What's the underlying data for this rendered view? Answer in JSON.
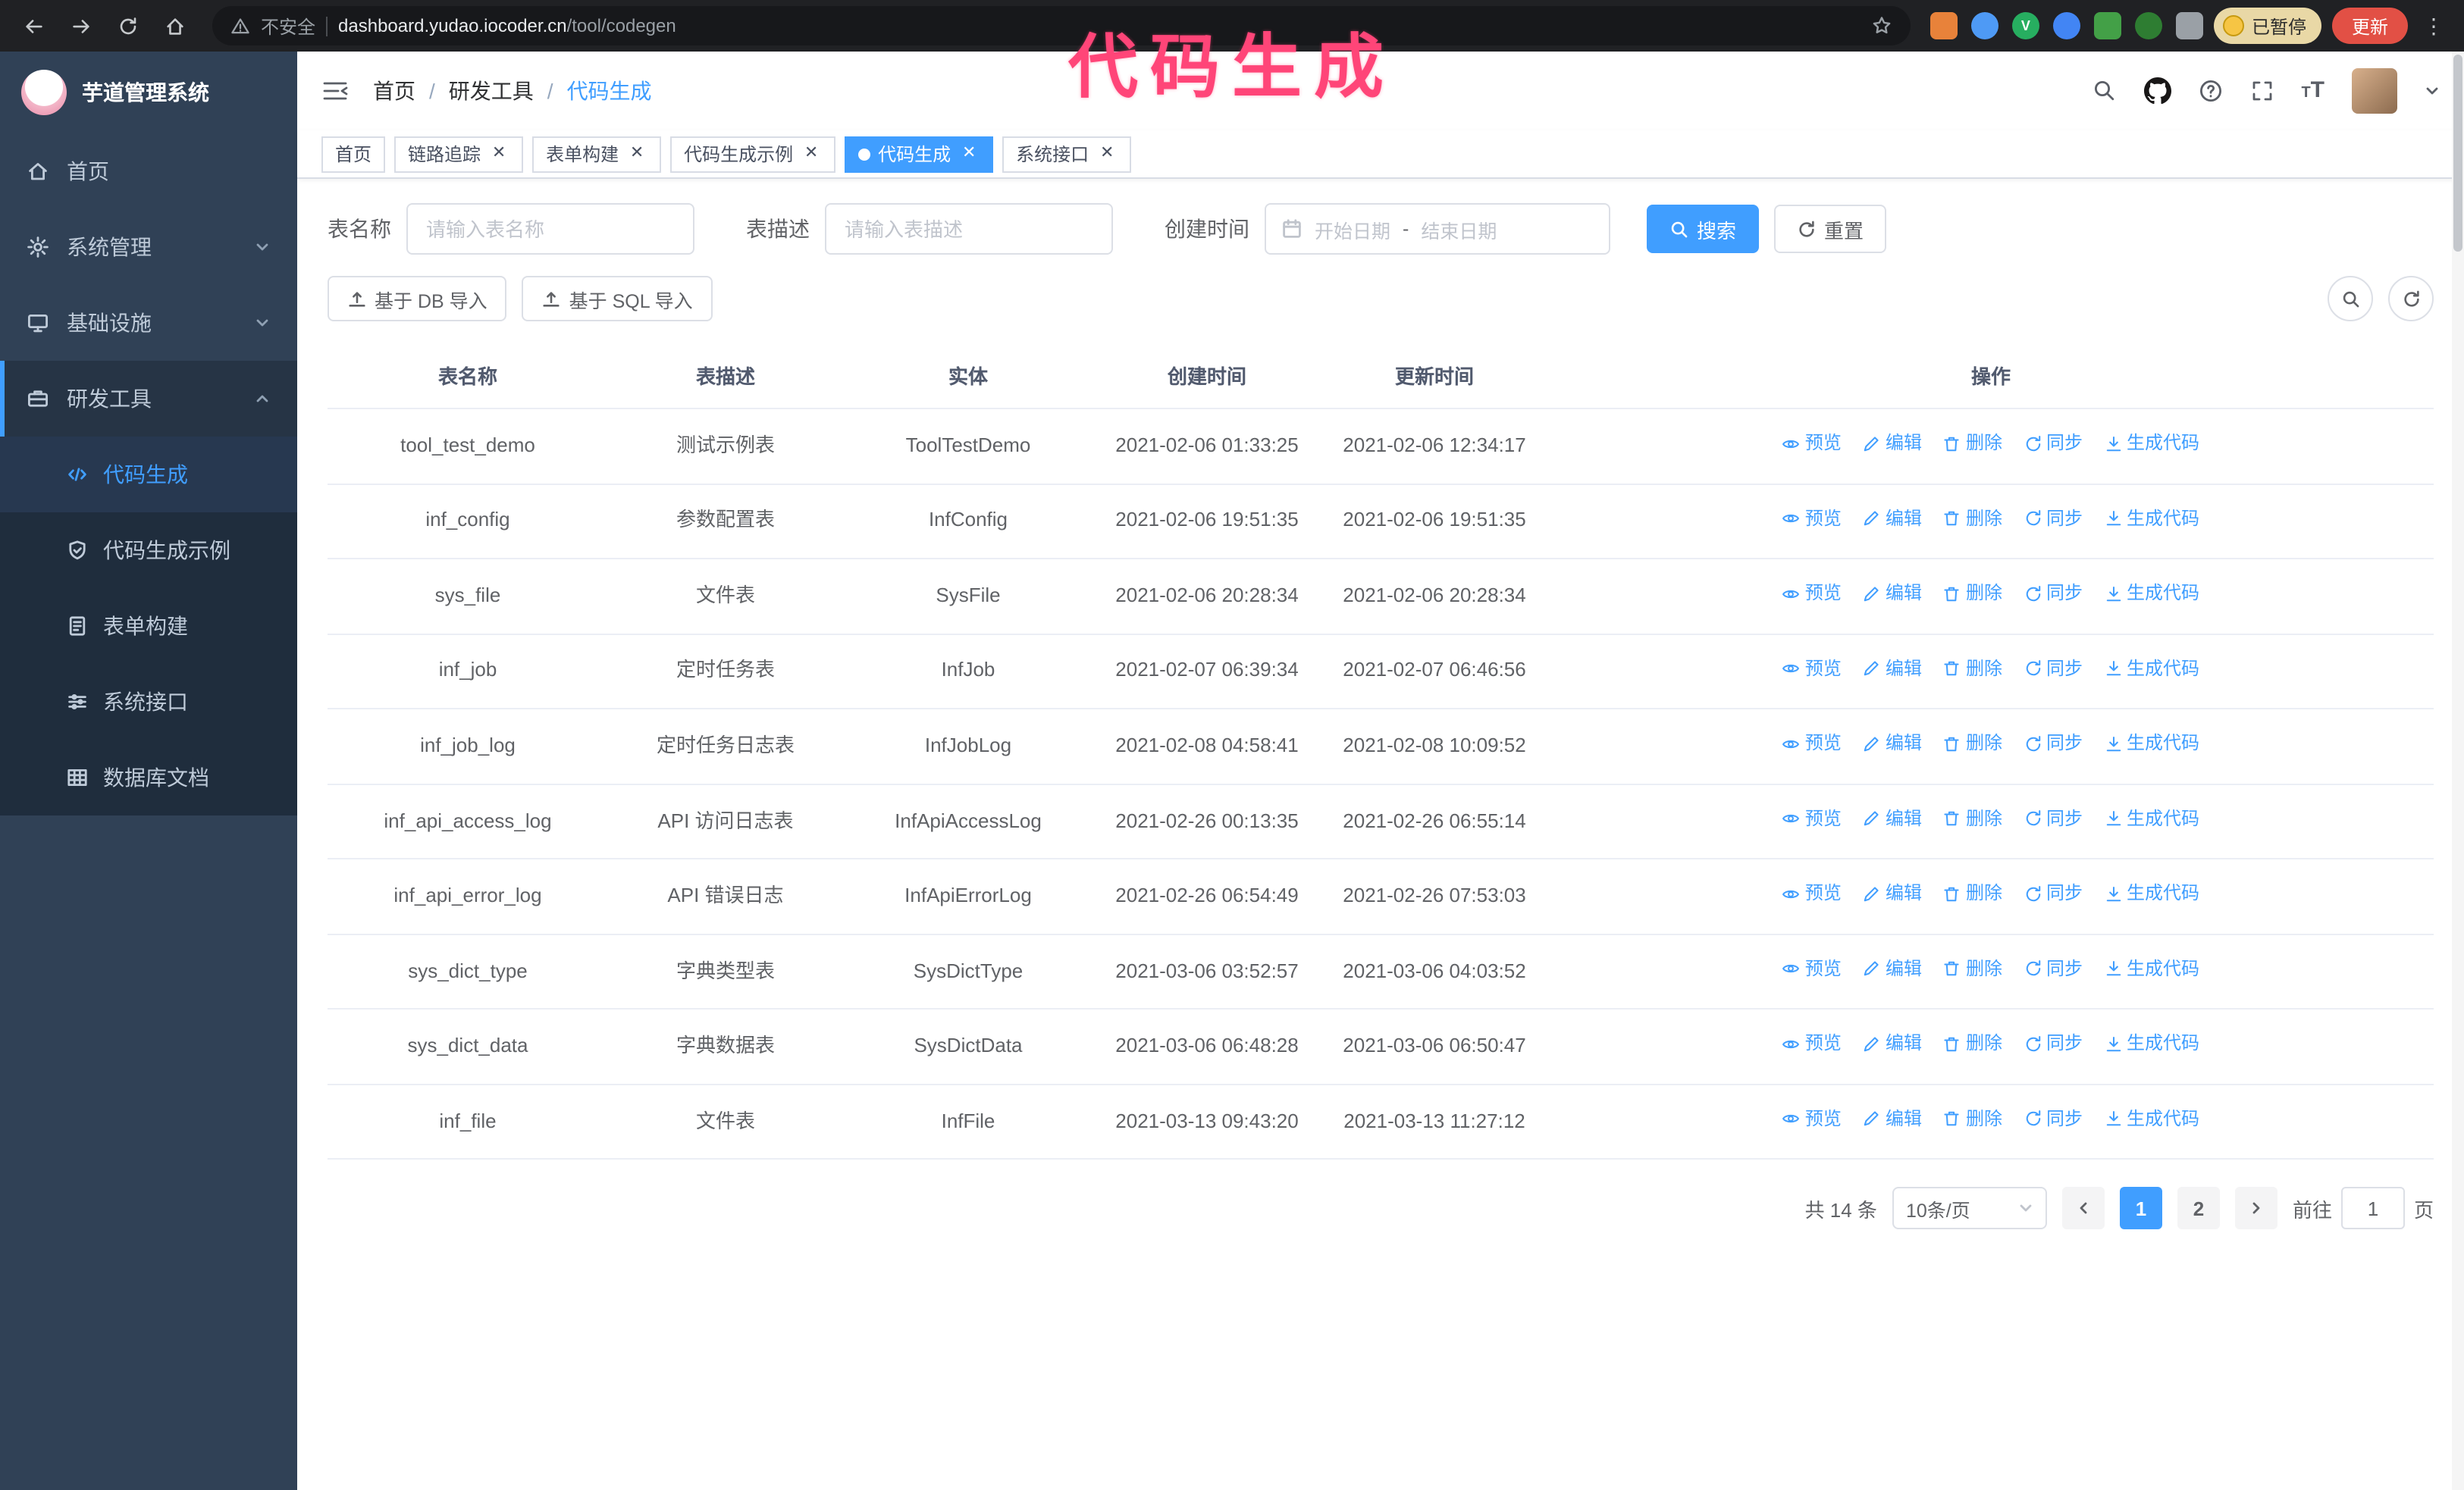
{
  "annotation": "代码生成",
  "browser": {
    "security_warning": "不安全",
    "url_domain": "dashboard.yudao.iocoder.cn",
    "url_path": "/tool/codegen",
    "ext_v_label": "V",
    "paused_badge": "已暂停",
    "update_button": "更新"
  },
  "app": {
    "title": "芋道管理系统",
    "breadcrumb": [
      "首页",
      "研发工具",
      "代码生成"
    ],
    "sidebar": {
      "items": [
        {
          "label": "首页"
        },
        {
          "label": "系统管理"
        },
        {
          "label": "基础设施"
        },
        {
          "label": "研发工具"
        }
      ],
      "submenu": [
        {
          "label": "代码生成"
        },
        {
          "label": "代码生成示例"
        },
        {
          "label": "表单构建"
        },
        {
          "label": "系统接口"
        },
        {
          "label": "数据库文档"
        }
      ]
    },
    "tabs": [
      {
        "label": "首页"
      },
      {
        "label": "链路追踪"
      },
      {
        "label": "表单构建"
      },
      {
        "label": "代码生成示例"
      },
      {
        "label": "代码生成"
      },
      {
        "label": "系统接口"
      }
    ],
    "filters": {
      "table_name_label": "表名称",
      "table_name_placeholder": "请输入表名称",
      "table_desc_label": "表描述",
      "table_desc_placeholder": "请输入表描述",
      "create_time_label": "创建时间",
      "date_start_placeholder": "开始日期",
      "date_separator": "-",
      "date_end_placeholder": "结束日期",
      "search_button": "搜索",
      "reset_button": "重置"
    },
    "toolbar": {
      "import_db": "基于 DB 导入",
      "import_sql": "基于 SQL 导入"
    },
    "table": {
      "columns": [
        "表名称",
        "表描述",
        "实体",
        "创建时间",
        "更新时间",
        "操作"
      ],
      "actions": [
        {
          "id": "preview",
          "label": "预览",
          "icon": "eye-icon"
        },
        {
          "id": "edit",
          "label": "编辑",
          "icon": "edit-icon"
        },
        {
          "id": "delete",
          "label": "删除",
          "icon": "delete-icon"
        },
        {
          "id": "sync",
          "label": "同步",
          "icon": "sync-icon"
        },
        {
          "id": "generate",
          "label": "生成代码",
          "icon": "generate-code-icon"
        }
      ],
      "rows": [
        {
          "name": "tool_test_demo",
          "desc": "测试示例表",
          "entity": "ToolTestDemo",
          "created": "2021-02-06 01:33:25",
          "updated": "2021-02-06 12:34:17"
        },
        {
          "name": "inf_config",
          "desc": "参数配置表",
          "entity": "InfConfig",
          "created": "2021-02-06 19:51:35",
          "updated": "2021-02-06 19:51:35"
        },
        {
          "name": "sys_file",
          "desc": "文件表",
          "entity": "SysFile",
          "created": "2021-02-06 20:28:34",
          "updated": "2021-02-06 20:28:34"
        },
        {
          "name": "inf_job",
          "desc": "定时任务表",
          "entity": "InfJob",
          "created": "2021-02-07 06:39:34",
          "updated": "2021-02-07 06:46:56"
        },
        {
          "name": "inf_job_log",
          "desc": "定时任务日志表",
          "entity": "InfJobLog",
          "created": "2021-02-08 04:58:41",
          "updated": "2021-02-08 10:09:52"
        },
        {
          "name": "inf_api_access_log",
          "desc": "API 访问日志表",
          "entity": "InfApiAccessLog",
          "created": "2021-02-26 00:13:35",
          "updated": "2021-02-26 06:55:14"
        },
        {
          "name": "inf_api_error_log",
          "desc": "API 错误日志",
          "entity": "InfApiErrorLog",
          "created": "2021-02-26 06:54:49",
          "updated": "2021-02-26 07:53:03"
        },
        {
          "name": "sys_dict_type",
          "desc": "字典类型表",
          "entity": "SysDictType",
          "created": "2021-03-06 03:52:57",
          "updated": "2021-03-06 04:03:52"
        },
        {
          "name": "sys_dict_data",
          "desc": "字典数据表",
          "entity": "SysDictData",
          "created": "2021-03-06 06:48:28",
          "updated": "2021-03-06 06:50:47"
        },
        {
          "name": "inf_file",
          "desc": "文件表",
          "entity": "InfFile",
          "created": "2021-03-13 09:43:20",
          "updated": "2021-03-13 11:27:12"
        }
      ]
    },
    "pagination": {
      "total": "共 14 条",
      "page_size": "10条/页",
      "pages": [
        "1",
        "2"
      ],
      "current": "1",
      "goto_label": "前往",
      "goto_value": "1",
      "page_suffix": "页"
    }
  },
  "colors": {
    "accent": "#409eff",
    "sidebar_bg": "#304156",
    "submenu_bg": "#1f2d3d",
    "annotation": "#ff4578",
    "update_button": "#e25045",
    "tag_active": "#409eff"
  }
}
